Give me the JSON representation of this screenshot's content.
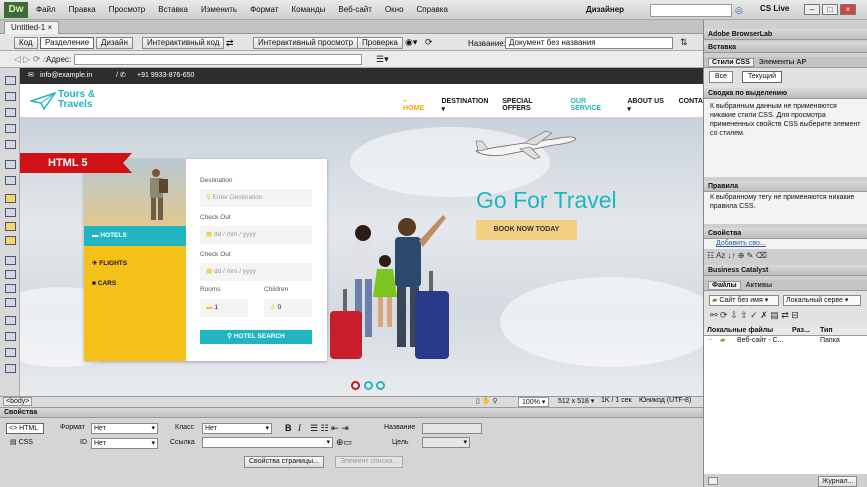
{
  "app": {
    "logo": "Dw",
    "menu": [
      "Файл",
      "Правка",
      "Просмотр",
      "Вставка",
      "Изменить",
      "Формат",
      "Команды",
      "Веб-сайт",
      "Окно",
      "Справка"
    ],
    "workspace": "Дизайнер",
    "cslive": "CS Live"
  },
  "doc": {
    "tab": "Untitled-1"
  },
  "toolbar": {
    "code": "Код",
    "split": "Разделение",
    "design": "Дизайн",
    "live_code": "Интерактивный код",
    "live_view": "Интерактивный просмотр",
    "inspect": "Проверка",
    "title_label": "Название:",
    "title_value": "Документ без названия"
  },
  "address": {
    "label": "Адрес:"
  },
  "site": {
    "email": "info@example.in",
    "phone": "+91 9933-876-650",
    "logo_line1": "Tours &",
    "logo_line2": "Travels",
    "nav": [
      "HOME",
      "DESTINATION",
      "SPECIAL OFFERS",
      "OUR SERVICE",
      "ABOUT US",
      "CONTA"
    ],
    "badge": "HTML 5",
    "tabs": [
      "HOTELS",
      "FLIGHTS",
      "CARS"
    ],
    "destination_label": "Destination",
    "destination_placeholder": "Enter Destination",
    "checkin_label": "Check Out",
    "checkin_placeholder": "dd / mm / yyyy",
    "checkout_label": "Check Out",
    "checkout_placeholder": "dd / mm / yyyy",
    "rooms_label": "Rooms",
    "rooms_value": "1",
    "children_label": "Children",
    "children_value": "0",
    "search_btn": "HOTEL SEARCH",
    "headline": "Go For Travel",
    "cta": "BOOK NOW TODAY",
    "colors": {
      "teal": "#21b5c2",
      "yellow": "#f5c118",
      "red": "#d01217",
      "dark": "#2e2e2e"
    }
  },
  "status": {
    "tag": "<body>",
    "zoom": "100%",
    "size": "512 x 518",
    "weight": "1K / 1 сек",
    "encoding": "Юникод (UTF-8)"
  },
  "props": {
    "title": "Свойства",
    "html": "HTML",
    "css": "CSS",
    "format_label": "Формат",
    "format_value": "Нет",
    "id_label": "ID",
    "id_value": "Нет",
    "class_label": "Класс",
    "class_value": "Нет",
    "link_label": "Ссылка",
    "name_label": "Название",
    "target_label": "Цель",
    "page_props": "Свойства страницы...",
    "list_item": "Элемент списка..."
  },
  "panels": {
    "browserlab": "Adobe BrowserLab",
    "insert": "Вставка",
    "css_styles": "Стили CSS",
    "ap": "Элементы AP",
    "all": "Все",
    "current": "Текущий",
    "summary_head": "Сводка по выделению",
    "summary_text": "К выбранным данным не применяются никакие стили CSS.  Для просмотра примененных свойств CSS выберите элемент со стилем.",
    "rules_head": "Правила",
    "rules_text": "К выбранному тегу не применяются никакие правила CSS.",
    "props_head": "Свойства",
    "add_prop": "Добавить сво...",
    "bc": "Business Catalyst",
    "files": "Файлы",
    "assets": "Активы",
    "site_select": "Сайт без имя",
    "view_select": "Локальный серве",
    "col_files": "Локальные файлы",
    "col_size": "Раз...",
    "col_type": "Тип",
    "row_name": "Веб-сайт - C...",
    "row_type": "Папка",
    "log": "Журнал..."
  }
}
